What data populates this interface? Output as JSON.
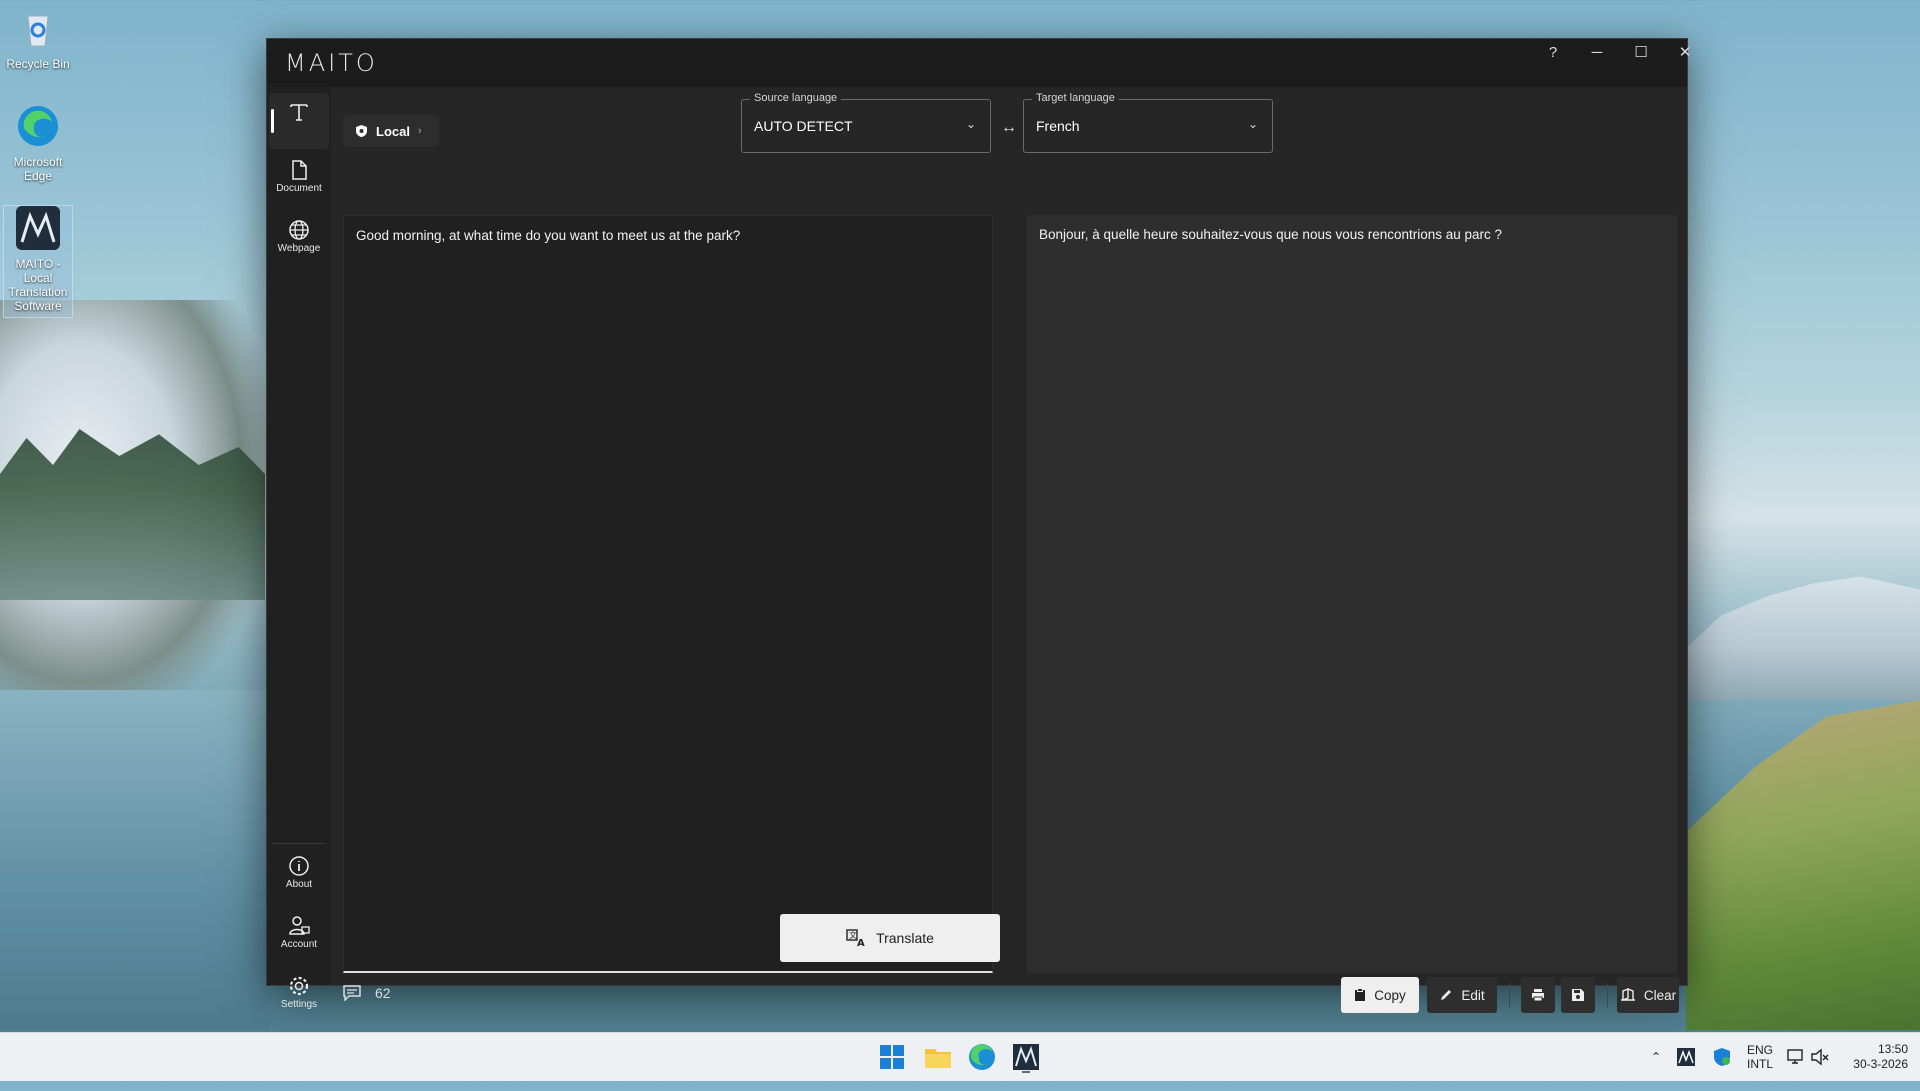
{
  "desktop": {
    "icons": [
      {
        "label": "Recycle Bin"
      },
      {
        "label": "Microsoft Edge"
      },
      {
        "label": "MAITO - Local Translation Software"
      }
    ]
  },
  "window": {
    "logo": "MAITO",
    "controls": {
      "help": "?",
      "minimize": "─",
      "maximize": "☐",
      "close": "✕"
    }
  },
  "sidebar": {
    "items": [
      {
        "label": "",
        "icon": "text-icon"
      },
      {
        "label": "Document",
        "icon": "document-icon"
      },
      {
        "label": "Webpage",
        "icon": "globe-icon"
      }
    ],
    "bottom": [
      {
        "label": "About",
        "icon": "info-icon"
      },
      {
        "label": "Account",
        "icon": "account-icon"
      },
      {
        "label": "Settings",
        "icon": "gear-icon"
      }
    ]
  },
  "toolbar": {
    "mode_label": "Local",
    "source_language_legend": "Source language",
    "source_language_value": "AUTO DETECT",
    "target_language_legend": "Target language",
    "target_language_value": "French"
  },
  "source": {
    "text": "Good morning, at what time do you want to meet us at the park?",
    "translate_label": "Translate",
    "char_count": "62"
  },
  "target": {
    "text": "Bonjour, à quelle heure souhaitez-vous que nous vous rencontrions au parc ?"
  },
  "actions": {
    "copy": "Copy",
    "edit": "Edit",
    "clear": "Clear"
  },
  "taskbar": {
    "lang_line1": "ENG",
    "lang_line2": "INTL",
    "time": "13:50",
    "date": "30-3-2026"
  },
  "colors": {
    "window_bg": "#202020",
    "panel_bg": "#262626",
    "target_panel_bg": "#2e2e2e",
    "accent_light": "#efefef"
  }
}
